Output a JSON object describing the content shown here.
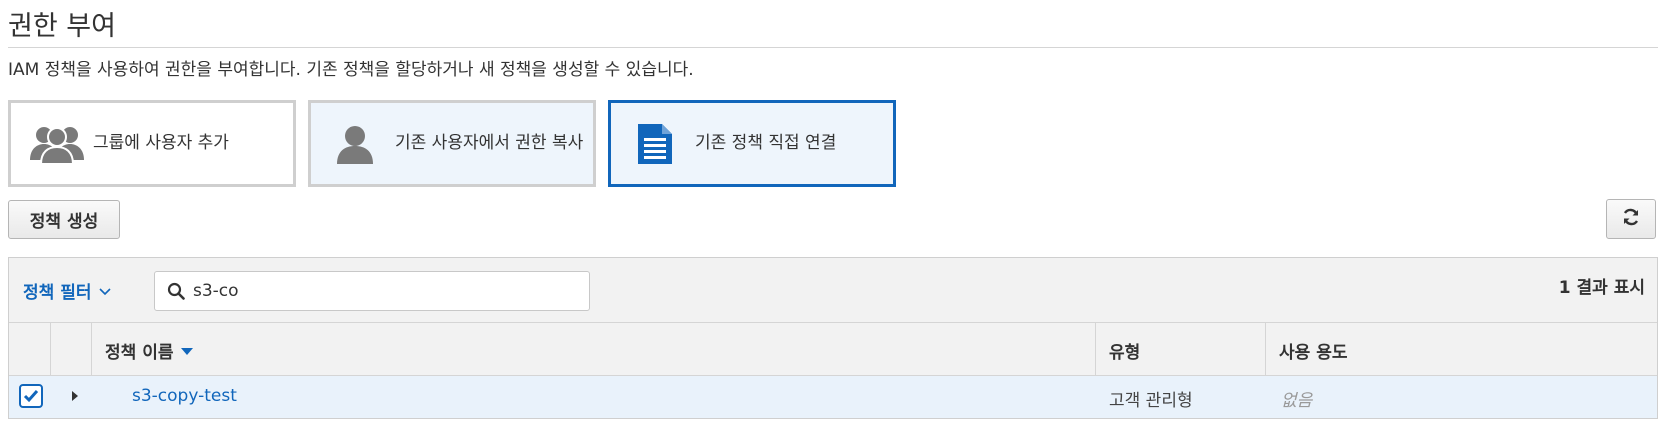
{
  "header": {
    "title": "권한 부여",
    "subtitle": "IAM 정책을 사용하여 권한을 부여합니다. 기존 정책을 할당하거나 새 정책을 생성할 수 있습니다."
  },
  "options": [
    {
      "label": "그룹에 사용자 추가",
      "icon": "users-icon"
    },
    {
      "label": "기존 사용자에서 권한 복사",
      "icon": "user-icon"
    },
    {
      "label": "기존 정책 직접 연결",
      "icon": "document-icon",
      "selected": true
    }
  ],
  "toolbar": {
    "create_policy_label": "정책 생성",
    "refresh_icon": "refresh-icon"
  },
  "filter": {
    "label": "정책 필터",
    "search_value": "s3-co",
    "result_count": "1 결과 표시"
  },
  "table": {
    "columns": [
      "정책 이름",
      "유형",
      "사용 용도"
    ],
    "sort_column": "정책 이름",
    "sort_direction": "descending",
    "rows": [
      {
        "checked": true,
        "name": "s3-copy-test",
        "type": "고객 관리형",
        "usage": "없음"
      }
    ]
  },
  "colors": {
    "accent": "#1166bb",
    "selected_row": "#e9f2fb",
    "header_bg": "#f2f2f2"
  }
}
